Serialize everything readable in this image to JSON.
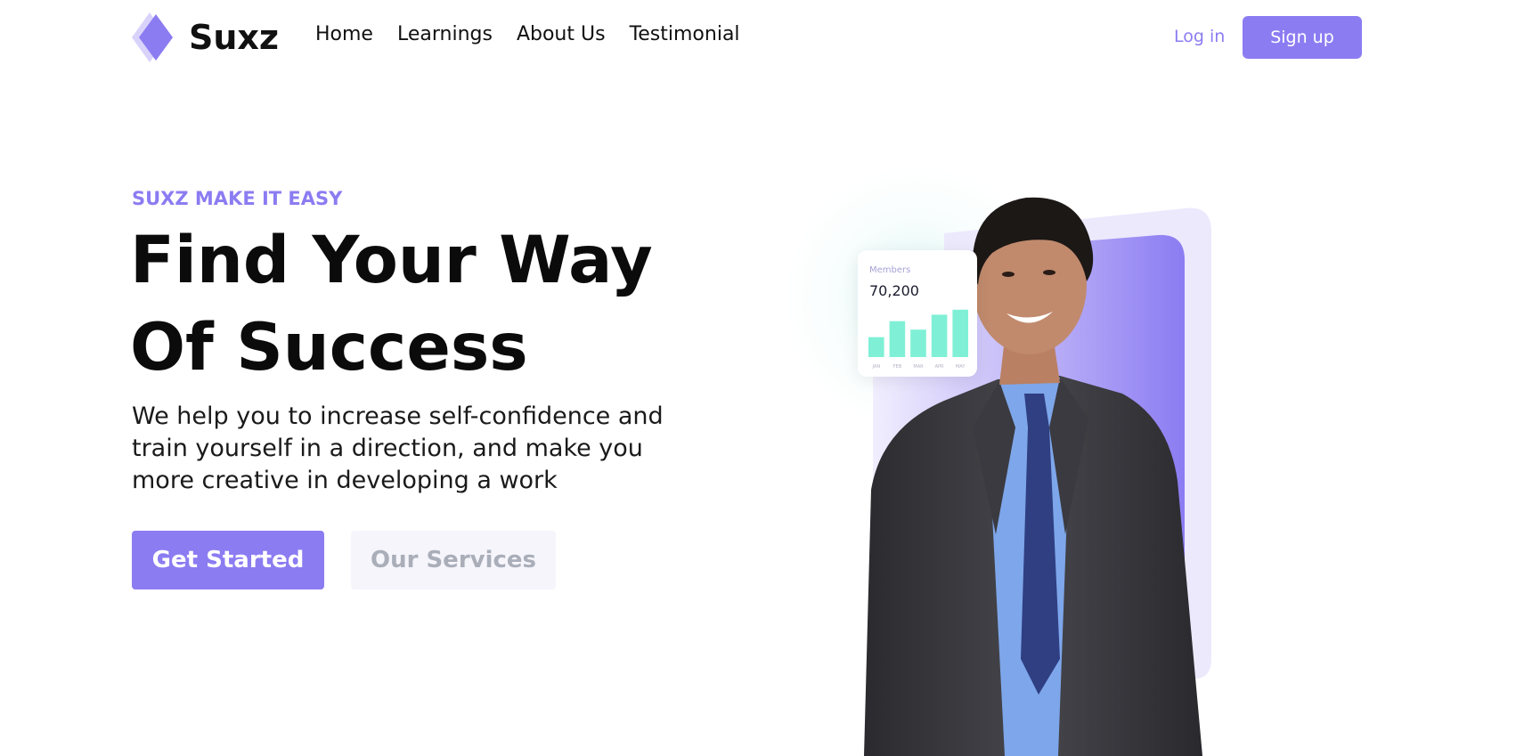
{
  "brand": {
    "name": "Suxz",
    "primary_color": "#8b7cf2"
  },
  "nav": {
    "items": [
      {
        "label": "Home"
      },
      {
        "label": "Learnings"
      },
      {
        "label": "About Us"
      },
      {
        "label": "Testimonial"
      }
    ]
  },
  "auth": {
    "login_label": "Log in",
    "signup_label": "Sign up"
  },
  "hero": {
    "eyebrow": "SUXZ MAKE IT EASY",
    "headline_line1": "Find Your Way",
    "headline_line2": "Of Success",
    "description": "We help you to increase self-confidence and train yourself in a direction, and make you more creative in developing a work",
    "primary_cta": "Get Started",
    "secondary_cta": "Our Services"
  },
  "stats_card": {
    "label": "Members",
    "value": "70,200",
    "bar_color": "#7ff0d6",
    "chart_data": {
      "type": "bar",
      "categories": [
        "JAN",
        "FEB",
        "MAR",
        "APR",
        "MAY"
      ],
      "values": [
        40,
        72,
        55,
        85,
        95
      ],
      "ylim": [
        0,
        100
      ]
    }
  }
}
